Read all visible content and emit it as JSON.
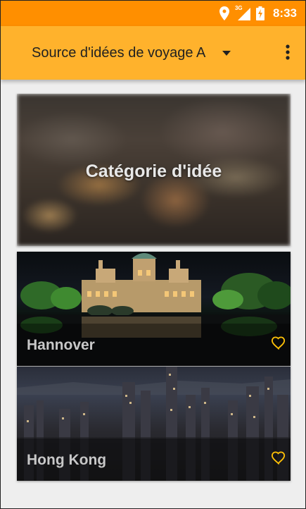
{
  "status_bar": {
    "time": "8:33",
    "network_label": "3G",
    "color": "#ff8f00"
  },
  "app_bar": {
    "title": "Source d'idées de voyage A",
    "color": "#ffb22c"
  },
  "hero_card": {
    "label": "Catégorie d'idée"
  },
  "cities": [
    {
      "name": "Hannover"
    },
    {
      "name": "Hong Kong"
    }
  ],
  "icons": {
    "location": "location-pin-icon",
    "signal": "cell-signal-icon",
    "battery": "battery-charging-icon",
    "dropdown": "dropdown-arrow-icon",
    "overflow": "more-vert-icon",
    "favorite": "heart-outline-icon"
  },
  "accent_colors": {
    "heart": "#ffc107"
  }
}
